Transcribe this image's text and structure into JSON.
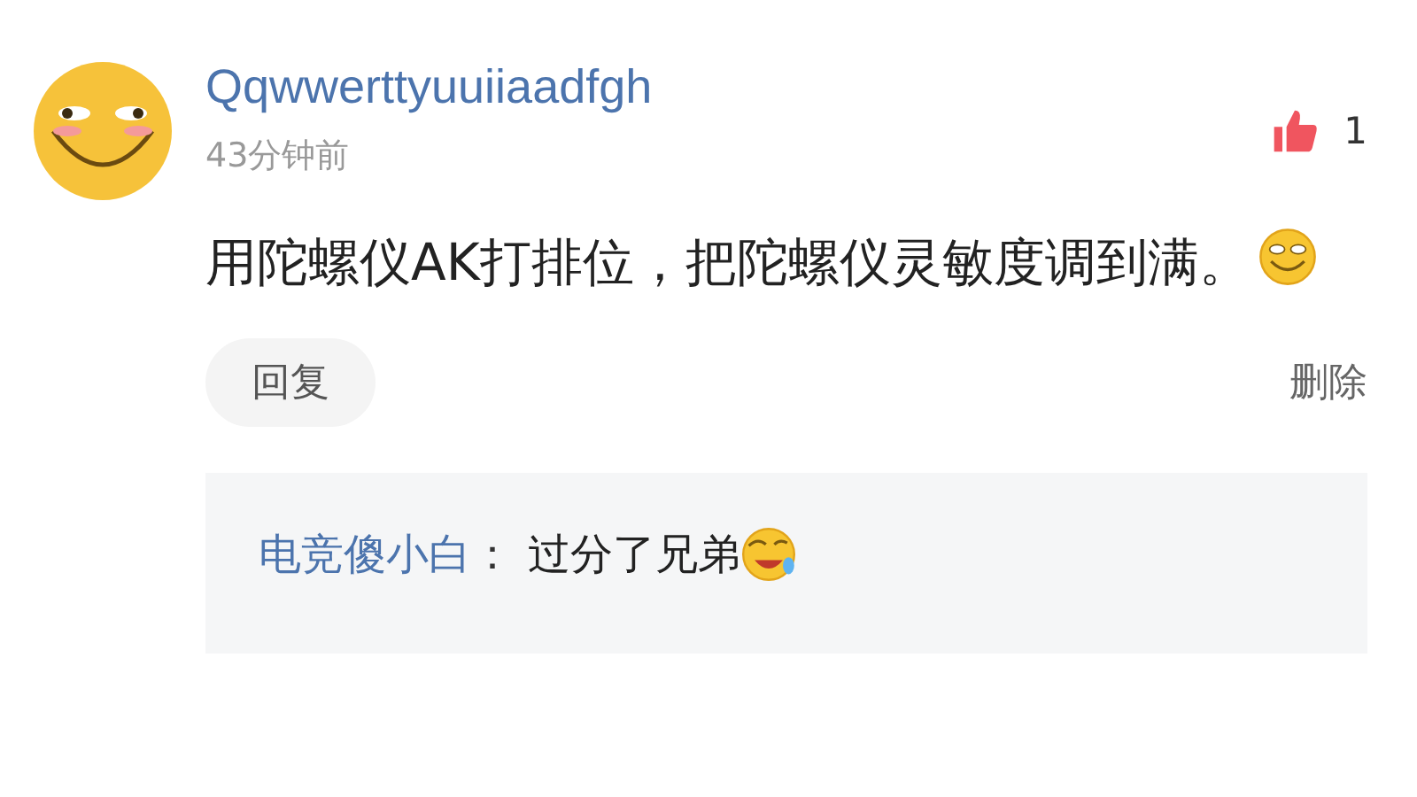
{
  "comment": {
    "author": "Qqwwerttyuuiiaadfgh",
    "time": "43分钟前",
    "likes": {
      "count": "1",
      "liked": true
    },
    "text": "用陀螺仪AK打排位，把陀螺仪灵敏度调到满。",
    "actions": {
      "reply": "回复",
      "delete": "删除"
    },
    "replies": [
      {
        "author": "电竞傻小白",
        "separator": "：",
        "text": "过分了兄弟"
      }
    ]
  }
}
